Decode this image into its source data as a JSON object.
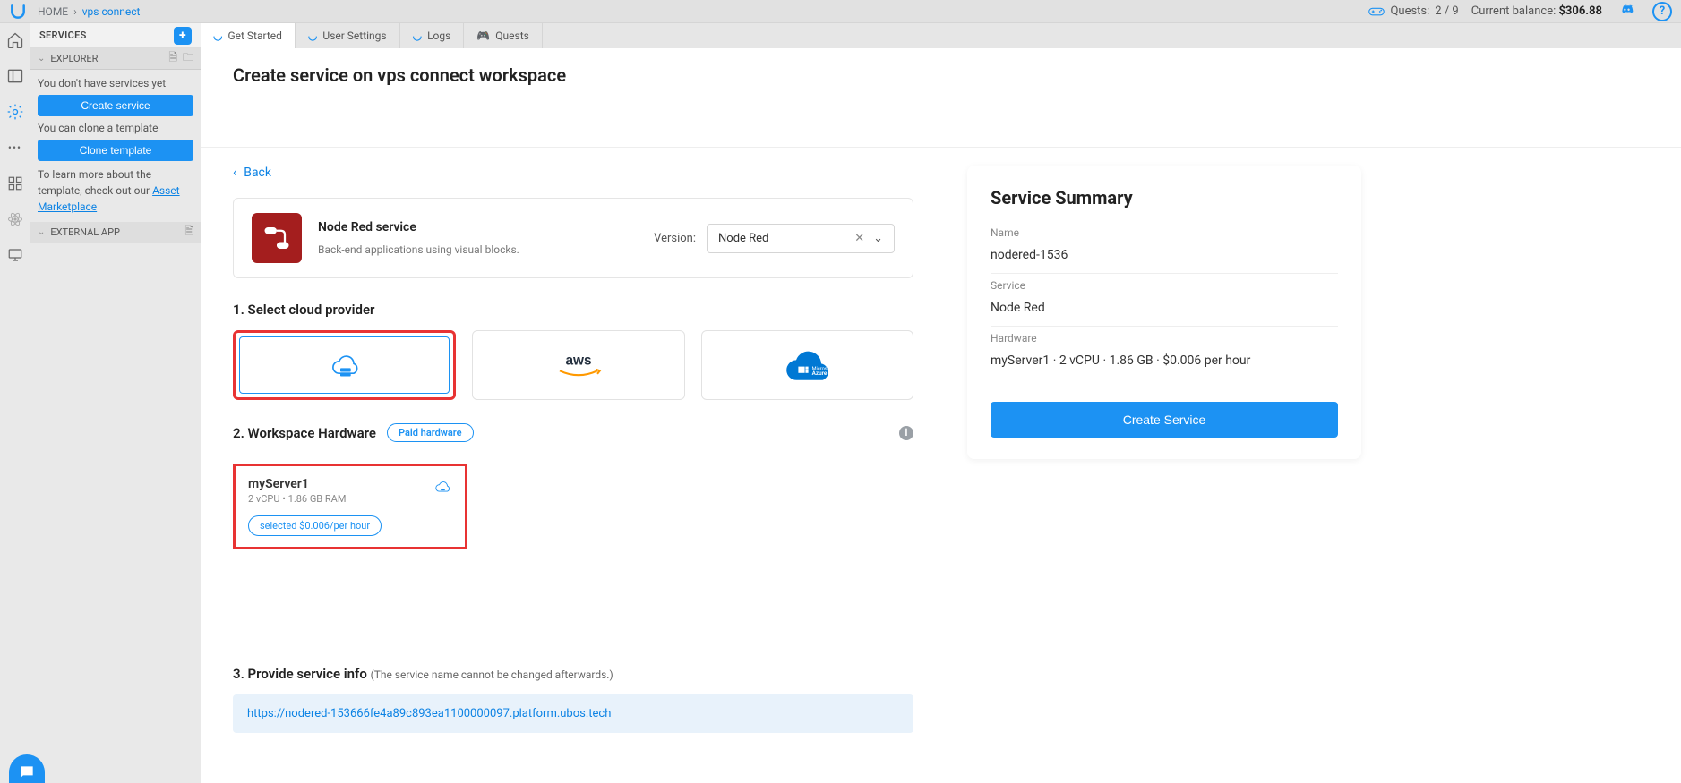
{
  "breadcrumb": {
    "home": "HOME",
    "current": "vps connect"
  },
  "topbar": {
    "quests_label": "Quests:",
    "quests_count": "2 / 9",
    "balance_label": "Current balance:",
    "balance_value": "$306.88"
  },
  "sidebar": {
    "services_title": "SERVICES",
    "explorer_title": "EXPLORER",
    "no_services_msg": "You don't have services yet",
    "create_service_btn": "Create service",
    "clone_msg": "You can clone a template",
    "clone_btn": "Clone template",
    "learn_more_prefix": "To learn more about the template, check out our ",
    "learn_more_link": "Asset Marketplace",
    "external_app_title": "EXTERNAL APP"
  },
  "tabs": {
    "get_started": "Get Started",
    "user_settings": "User Settings",
    "logs": "Logs",
    "quests": "Quests"
  },
  "page": {
    "title": "Create service on vps connect workspace",
    "back": "Back"
  },
  "service_card": {
    "name": "Node Red service",
    "desc": "Back-end applications using  visual blocks.",
    "version_label": "Version:",
    "version_value": "Node Red"
  },
  "section1": {
    "title": "1. Select cloud provider"
  },
  "section2": {
    "title": "2. Workspace Hardware",
    "paid_badge": "Paid hardware"
  },
  "hardware": {
    "name": "myServer1",
    "spec": "2 vCPU • 1.86 GB RAM",
    "selected_label": "selected $0.006/per hour"
  },
  "section3": {
    "title": "3. Provide service info",
    "note": "(The service name cannot be changed afterwards.)",
    "url": "https://nodered-153666fe4a89c893ea1100000097.platform.ubos.tech"
  },
  "summary": {
    "title": "Service Summary",
    "name_label": "Name",
    "name_value": "nodered-1536",
    "service_label": "Service",
    "service_value": "Node Red",
    "hardware_label": "Hardware",
    "hardware_value": "myServer1 · 2 vCPU · 1.86 GB · $0.006 per hour",
    "create_btn": "Create Service"
  }
}
